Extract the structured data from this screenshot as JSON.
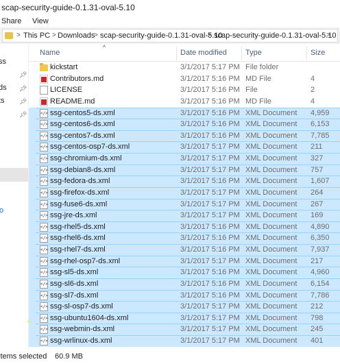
{
  "window": {
    "title": "scap-security-guide-0.1.31-oval-5.10"
  },
  "ribbon": {
    "tabs": [
      "Share",
      "View"
    ]
  },
  "address": {
    "crumbs": [
      "This PC",
      "Downloads",
      "scap-security-guide-0.1.31-oval-5.10",
      "scap-security-guide-0.1.31-oval-5.10"
    ],
    "separator": ">"
  },
  "sidebar": {
    "items": [
      "ss",
      "ds",
      "ts",
      "o"
    ]
  },
  "columns": {
    "name": "Name",
    "date": "Date modified",
    "type": "Type",
    "size": "Size"
  },
  "files": [
    {
      "name": "kickstart",
      "date": "3/1/2017 5:17 PM",
      "type": "File folder",
      "size": "",
      "icon": "folder",
      "selected": false
    },
    {
      "name": "Contributors.md",
      "date": "3/1/2017 5:16 PM",
      "type": "MD File",
      "size": "4",
      "icon": "md-file",
      "selected": false
    },
    {
      "name": "LICENSE",
      "date": "3/1/2017 5:16 PM",
      "type": "File",
      "size": "2",
      "icon": "file",
      "selected": false
    },
    {
      "name": "README.md",
      "date": "3/1/2017 5:16 PM",
      "type": "MD File",
      "size": "4",
      "icon": "md-file",
      "selected": false
    },
    {
      "name": "ssg-centos5-ds.xml",
      "date": "3/1/2017 5:16 PM",
      "type": "XML Document",
      "size": "4,959",
      "icon": "xml-document",
      "selected": true
    },
    {
      "name": "ssg-centos6-ds.xml",
      "date": "3/1/2017 5:16 PM",
      "type": "XML Document",
      "size": "6,153",
      "icon": "xml-document",
      "selected": true
    },
    {
      "name": "ssg-centos7-ds.xml",
      "date": "3/1/2017 5:16 PM",
      "type": "XML Document",
      "size": "7,785",
      "icon": "xml-document",
      "selected": true
    },
    {
      "name": "ssg-centos-osp7-ds.xml",
      "date": "3/1/2017 5:17 PM",
      "type": "XML Document",
      "size": "211",
      "icon": "xml-document",
      "selected": true
    },
    {
      "name": "ssg-chromium-ds.xml",
      "date": "3/1/2017 5:17 PM",
      "type": "XML Document",
      "size": "327",
      "icon": "xml-document",
      "selected": true
    },
    {
      "name": "ssg-debian8-ds.xml",
      "date": "3/1/2017 5:17 PM",
      "type": "XML Document",
      "size": "757",
      "icon": "xml-document",
      "selected": true
    },
    {
      "name": "ssg-fedora-ds.xml",
      "date": "3/1/2017 5:16 PM",
      "type": "XML Document",
      "size": "1,607",
      "icon": "xml-document",
      "selected": true
    },
    {
      "name": "ssg-firefox-ds.xml",
      "date": "3/1/2017 5:17 PM",
      "type": "XML Document",
      "size": "264",
      "icon": "xml-document",
      "selected": true
    },
    {
      "name": "ssg-fuse6-ds.xml",
      "date": "3/1/2017 5:17 PM",
      "type": "XML Document",
      "size": "267",
      "icon": "xml-document",
      "selected": true
    },
    {
      "name": "ssg-jre-ds.xml",
      "date": "3/1/2017 5:17 PM",
      "type": "XML Document",
      "size": "169",
      "icon": "xml-document",
      "selected": true
    },
    {
      "name": "ssg-rhel5-ds.xml",
      "date": "3/1/2017 5:16 PM",
      "type": "XML Document",
      "size": "4,890",
      "icon": "xml-document",
      "selected": true
    },
    {
      "name": "ssg-rhel6-ds.xml",
      "date": "3/1/2017 5:16 PM",
      "type": "XML Document",
      "size": "6,350",
      "icon": "xml-document",
      "selected": true
    },
    {
      "name": "ssg-rhel7-ds.xml",
      "date": "3/1/2017 5:16 PM",
      "type": "XML Document",
      "size": "7,937",
      "icon": "xml-document",
      "selected": true
    },
    {
      "name": "ssg-rhel-osp7-ds.xml",
      "date": "3/1/2017 5:17 PM",
      "type": "XML Document",
      "size": "217",
      "icon": "xml-document",
      "selected": true
    },
    {
      "name": "ssg-sl5-ds.xml",
      "date": "3/1/2017 5:16 PM",
      "type": "XML Document",
      "size": "4,960",
      "icon": "xml-document",
      "selected": true
    },
    {
      "name": "ssg-sl6-ds.xml",
      "date": "3/1/2017 5:16 PM",
      "type": "XML Document",
      "size": "6,154",
      "icon": "xml-document",
      "selected": true
    },
    {
      "name": "ssg-sl7-ds.xml",
      "date": "3/1/2017 5:16 PM",
      "type": "XML Document",
      "size": "7,786",
      "icon": "xml-document",
      "selected": true
    },
    {
      "name": "ssg-sl-osp7-ds.xml",
      "date": "3/1/2017 5:17 PM",
      "type": "XML Document",
      "size": "212",
      "icon": "xml-document",
      "selected": true
    },
    {
      "name": "ssg-ubuntu1604-ds.xml",
      "date": "3/1/2017 5:17 PM",
      "type": "XML Document",
      "size": "798",
      "icon": "xml-document",
      "selected": true
    },
    {
      "name": "ssg-webmin-ds.xml",
      "date": "3/1/2017 5:17 PM",
      "type": "XML Document",
      "size": "245",
      "icon": "xml-document",
      "selected": true
    },
    {
      "name": "ssg-wrlinux-ds.xml",
      "date": "3/1/2017 5:17 PM",
      "type": "XML Document",
      "size": "401",
      "icon": "xml-document",
      "selected": true
    }
  ],
  "status": {
    "selected_text": "items selected",
    "size_text": "60.9 MB"
  },
  "colors": {
    "selection": "#cce8ff",
    "selection_border": "#99d1ff",
    "highlight": "#f2f21a",
    "header_text": "#4c607a"
  }
}
